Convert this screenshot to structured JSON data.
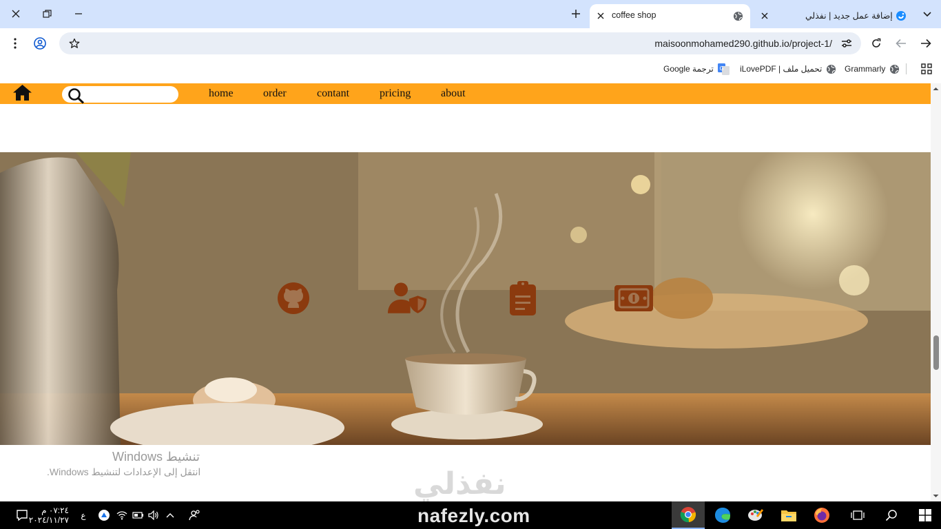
{
  "browser": {
    "tabs": [
      {
        "title": "coffee shop",
        "active": true,
        "icon": "globe-icon"
      },
      {
        "title": "إضافة عمل جديد | نفذلي",
        "active": false,
        "icon": "nafezly-icon"
      }
    ],
    "new_tab_icon": "plus-icon",
    "tab_search_icon": "chevron-down-icon",
    "window_controls": [
      "close-icon",
      "restore-icon",
      "minimize-icon"
    ],
    "url": "maisoonmohamed290.github.io/project-1/",
    "bookmarks": [
      {
        "label": "Grammarly",
        "icon": "globe-icon"
      },
      {
        "label": "iLovePDF | تحميل ملف",
        "icon": "globe-icon"
      },
      {
        "label": "Google ترجمة",
        "icon": "translate-icon"
      }
    ]
  },
  "page": {
    "nav_links": [
      "home",
      "order",
      "contant",
      "pricing",
      "about"
    ],
    "search_value": "",
    "hero_icons": [
      "github-icon",
      "user-shield-icon",
      "clipboard-icon",
      "money-bill-icon"
    ],
    "accent_color": "#ffa41b",
    "icon_color": "#8b3a0e"
  },
  "overlay": {
    "activation_title": "تنشيط Windows",
    "activation_subtitle": "انتقل إلى الإعدادات لتنشيط Windows.",
    "brand_arabic": "نفذلي",
    "brand_latin": "nafezly.com"
  },
  "taskbar": {
    "time": "٠٧:٢٤ م",
    "date": "٢٠٢٤/١١/٢٧",
    "lang": "ع"
  }
}
